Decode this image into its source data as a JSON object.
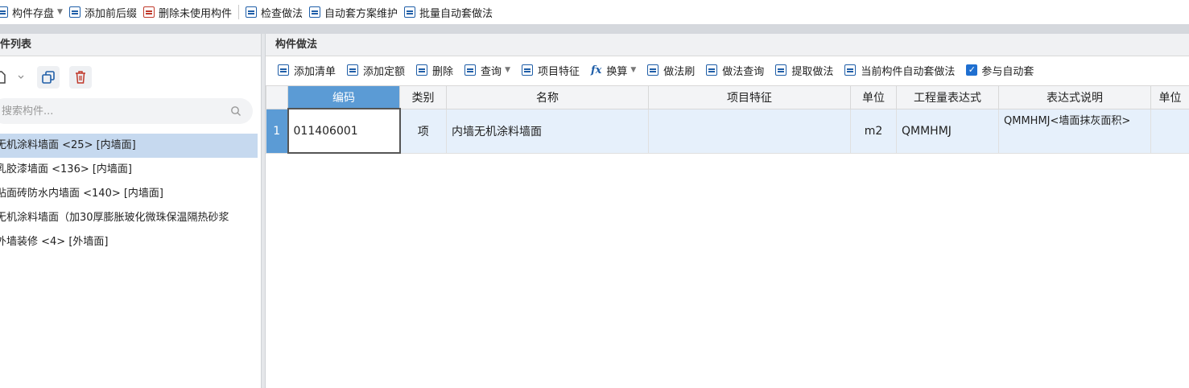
{
  "toolbar": {
    "items": [
      {
        "label": "构件存盘",
        "dropdown": true,
        "icon": "save-icon"
      },
      {
        "label": "添加前后缀",
        "icon": "prefix-suffix-icon"
      },
      {
        "label": "删除未使用构件",
        "icon": "delete-unused-icon"
      },
      {
        "label": "检查做法",
        "icon": "check-method-icon"
      },
      {
        "label": "自动套方案维护",
        "icon": "auto-scheme-icon"
      },
      {
        "label": "批量自动套做法",
        "icon": "batch-auto-icon"
      }
    ]
  },
  "left_panel": {
    "title": "件列表",
    "search_placeholder": "搜索构件...",
    "items": [
      {
        "label": "无机涂料墙面 <25> [内墙面]",
        "selected": true
      },
      {
        "label": "乳胶漆墙面 <136> [内墙面]",
        "selected": false
      },
      {
        "label": "贴面砖防水内墙面 <140> [内墙面]",
        "selected": false
      },
      {
        "label": "无机涂料墙面（加30厚膨胀玻化微珠保温隔热砂浆",
        "selected": false
      },
      {
        "label": "外墙装修 <4> [外墙面]",
        "selected": false
      }
    ]
  },
  "right_panel": {
    "title": "构件做法",
    "toolbar": {
      "add_list": "添加清单",
      "add_quota": "添加定额",
      "delete": "删除",
      "query": "查询",
      "item_feature": "项目特征",
      "convert": "换算",
      "method_brush": "做法刷",
      "method_query": "做法查询",
      "extract_method": "提取做法",
      "current_auto": "当前构件自动套做法",
      "join_auto": "参与自动套",
      "join_auto_checked": true
    },
    "grid": {
      "columns": [
        "编码",
        "类别",
        "名称",
        "项目特征",
        "单位",
        "工程量表达式",
        "表达式说明",
        "单位"
      ],
      "rows": [
        {
          "num": "1",
          "code": "011406001",
          "category": "项",
          "name": "内墙无机涂料墙面",
          "feature": "",
          "unit": "m2",
          "expr": "QMMHMJ",
          "desc": "QMMHMJ<墙面抹灰面积>"
        }
      ]
    }
  },
  "colors": {
    "accent": "#5b9bd5",
    "selected_row": "#c6d9ef",
    "row_bg": "#e6f0fb"
  }
}
